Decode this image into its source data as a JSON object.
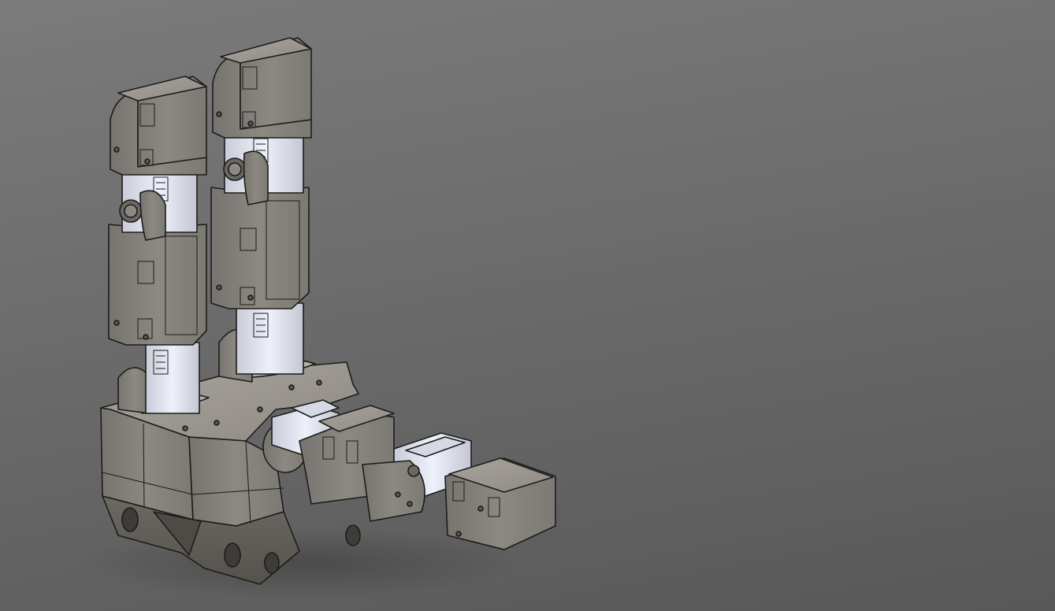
{
  "viewport": {
    "background_top": "#7b7b7b",
    "background_bottom": "#585858"
  },
  "model": {
    "part_color": "#8a8680",
    "part_shadow_color": "#5f5c57",
    "part_highlight_color": "#a29e97",
    "servo_color": "#e3e6f2",
    "edge_color": "#1c1c1a"
  }
}
